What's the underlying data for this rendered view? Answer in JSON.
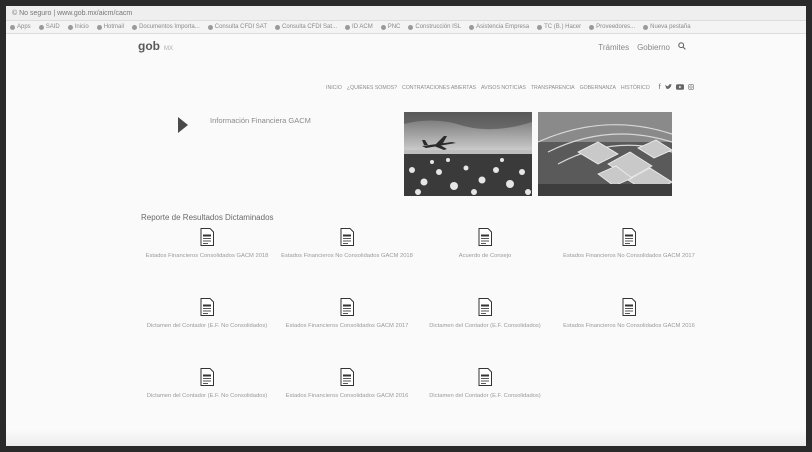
{
  "browser": {
    "url": "© No seguro | www.gob.mx/aicm/cacm",
    "bookmarks": [
      "Apps",
      "SAID",
      "Inicio",
      "Hotmail",
      "Documentos Importa...",
      "Consulta CFDI SAT",
      "Consulta CFDI Sat...",
      "ID ACM",
      "PNC",
      "Construcción ISL",
      "Asistencia Empresa",
      "TC (B.) Hacer",
      "Proveedores...",
      "Nueva pestaña"
    ]
  },
  "header": {
    "logo": "gob",
    "logo_suffix": "MX",
    "tramites": "Trámites",
    "gobierno": "Gobierno"
  },
  "nav": {
    "items": [
      "INICIO",
      "¿QUIÉNES SOMOS?",
      "CONTRATACIONES ABIERTAS",
      "AVISOS NOTICIAS",
      "TRANSPARENCIA",
      "GOBERNANZA",
      "HISTÓRICO"
    ]
  },
  "hero": {
    "title": "Información Financiera GACM"
  },
  "section": {
    "title": "Reporte de Resultados Dictaminados"
  },
  "documents": [
    {
      "label": "Estados Financieros Consolidados GACM 2018"
    },
    {
      "label": "Estados Financieros No Consolidados GACM 2018"
    },
    {
      "label": "Acuerdo de Consejo"
    },
    {
      "label": "Estados Financieros No Consolidados GACM 2017"
    },
    {
      "label": "Dictamen del Contador (E.F. No Consolidados)"
    },
    {
      "label": "Estados Financieros Consolidados GACM 2017"
    },
    {
      "label": "Dictamen del Contador (E.F. Consolidados)"
    },
    {
      "label": "Estados Financieros No Consolidados GACM 2016"
    },
    {
      "label": "Dictamen del Contador (E.F. No Consolidados)"
    },
    {
      "label": "Estados Financieros Consolidados GACM 2016"
    },
    {
      "label": "Dictamen del Contador (E.F. Consolidados)"
    }
  ],
  "icons": {
    "document": "document-icon",
    "search": "search-icon",
    "facebook": "facebook-icon",
    "twitter": "twitter-icon",
    "youtube": "youtube-icon",
    "instagram": "instagram-icon"
  }
}
